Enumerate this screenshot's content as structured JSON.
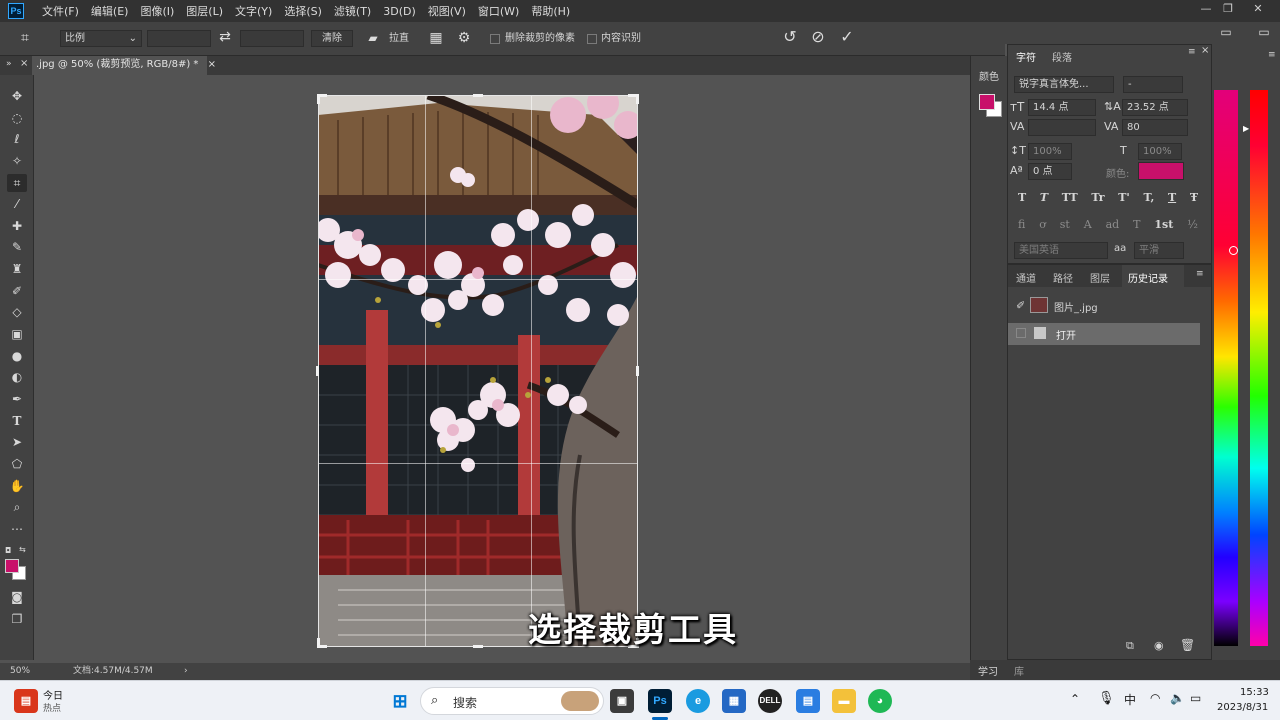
{
  "app": {
    "logo": "Ps"
  },
  "menu": [
    "文件(F)",
    "编辑(E)",
    "图像(I)",
    "图层(L)",
    "文字(Y)",
    "选择(S)",
    "滤镜(T)",
    "3D(D)",
    "视图(V)",
    "窗口(W)",
    "帮助(H)"
  ],
  "options_bar": {
    "ratio_select": "比例",
    "clear_button": "清除",
    "straighten_label": "拉直",
    "delete_cropped_label": "删除裁剪的像素",
    "content_aware_label": "内容识别"
  },
  "document_tab": {
    "title": ".jpg @ 50% (裁剪预览, RGB/8#) *",
    "close": "×"
  },
  "subtitle": "选择裁剪工具",
  "status_bar": {
    "zoom": "50%",
    "doc_info": "文档:4.57M/4.57M",
    "arrow": "›"
  },
  "color_panel": {
    "label": "颜色",
    "foreground_color": "#c8106a",
    "background_color": "#ffffff"
  },
  "character_panel": {
    "tabs": [
      "字符",
      "段落"
    ],
    "font_family": "锐字真言体免...",
    "font_style": "-",
    "font_size": "14.4 点",
    "leading": "23.52 点",
    "kerning": "",
    "tracking": "80",
    "vertical_scale": "100%",
    "horizontal_scale": "100%",
    "baseline_shift": "0 点",
    "color_label": "颜色:",
    "text_color": "#c8106a",
    "style_buttons": [
      "T",
      "T",
      "TT",
      "Tr",
      "T'",
      "T,",
      "T",
      "Ŧ"
    ],
    "opentype_buttons": [
      "fi",
      "ơ",
      "st",
      "A",
      "ad",
      "T",
      "1st",
      "½"
    ],
    "language": "美国英语",
    "aa_label": "aa",
    "antialias": "平滑"
  },
  "history_panel": {
    "tabs": [
      "通道",
      "路径",
      "图层",
      "历史记录"
    ],
    "snapshot": "图片_.jpg",
    "items": [
      "打开"
    ]
  },
  "learn_panel": {
    "label": "学习",
    "library_label": "库"
  },
  "taskbar": {
    "news_title": "今日",
    "news_sub": "热点",
    "search_placeholder": "搜索",
    "ime": "中",
    "time": "15:33",
    "date": "2023/8/31"
  }
}
